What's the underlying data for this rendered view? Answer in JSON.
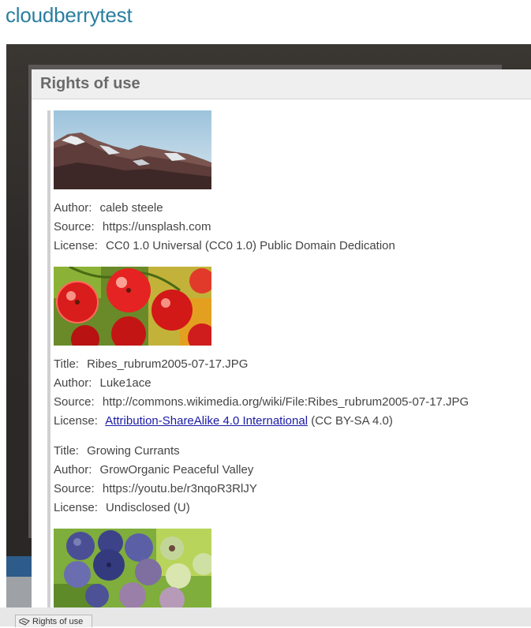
{
  "site": {
    "title": "cloudberrytest"
  },
  "dialog": {
    "title": "Rights of use",
    "entries": [
      {
        "image": "mountain-image",
        "author_key": "Author:",
        "author": "caleb steele",
        "source_key": "Source:",
        "source": "https://unsplash.com",
        "license_key": "License:",
        "license": "CC0 1.0 Universal (CC0 1.0) Public Domain Dedication"
      },
      {
        "image": "red-currant-image",
        "title_key": "Title:",
        "title": "Ribes_rubrum2005-07-17.JPG",
        "author_key": "Author:",
        "author": "Luke1ace",
        "source_key": "Source:",
        "source": "http://commons.wikimedia.org/wiki/File:Ribes_rubrum2005-07-17.JPG",
        "license_key": "License:",
        "license_link": "Attribution-ShareAlike 4.0 International",
        "license_suffix": "(CC BY-SA 4.0)"
      },
      {
        "title_key": "Title:",
        "title": "Growing Currants",
        "author_key": "Author:",
        "author": "GrowOrganic Peaceful Valley",
        "source_key": "Source:",
        "source": "https://youtu.be/r3nqoR3RlJY",
        "license_key": "License:",
        "license": "Undisclosed (U)"
      },
      {
        "image": "blueberry-image"
      }
    ]
  },
  "bottom_bar": {
    "rights_button_label": "Rights of use"
  },
  "colors": {
    "site_title": "#2a7ea0",
    "link": "#1a1aa6",
    "header_bg": "#efefef",
    "overlay": "#2c2a28"
  }
}
